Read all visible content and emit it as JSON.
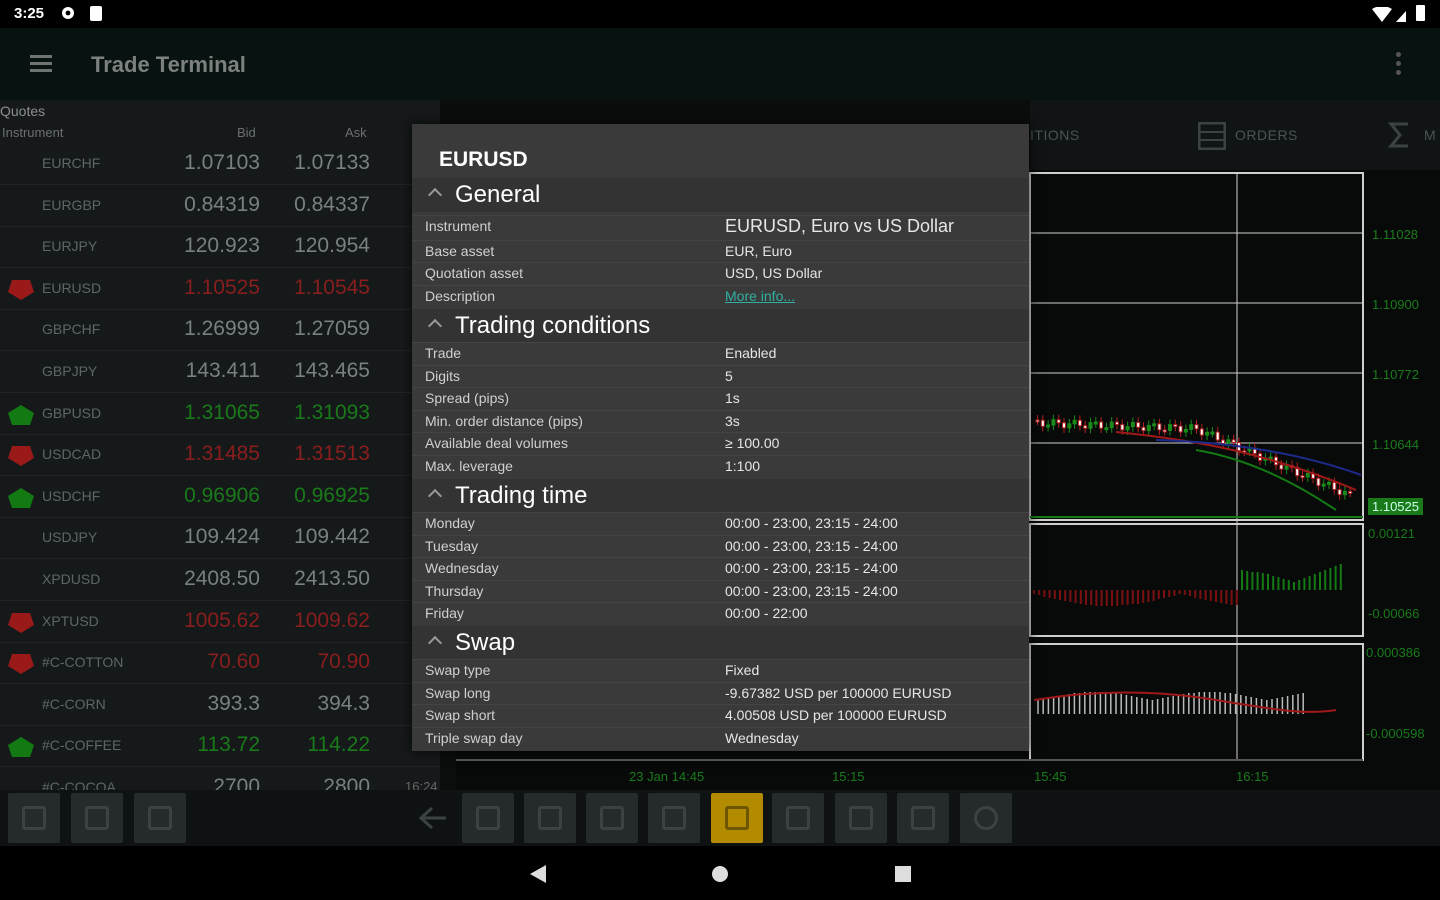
{
  "status_bar": {
    "time": "3:25"
  },
  "app_bar": {
    "title": "Trade Terminal"
  },
  "quotes": {
    "title": "Quotes",
    "headers": {
      "instrument": "Instrument",
      "bid": "Bid",
      "ask": "Ask"
    },
    "rows": [
      {
        "instrument": "EURCHF",
        "bid": "1.07103",
        "ask": "1.07133",
        "dir": "none"
      },
      {
        "instrument": "EURGBP",
        "bid": "0.84319",
        "ask": "0.84337",
        "dir": "none"
      },
      {
        "instrument": "EURJPY",
        "bid": "120.923",
        "ask": "120.954",
        "dir": "none"
      },
      {
        "instrument": "EURUSD",
        "bid": "1.10525",
        "ask": "1.10545",
        "dir": "down"
      },
      {
        "instrument": "GBPCHF",
        "bid": "1.26999",
        "ask": "1.27059",
        "dir": "none"
      },
      {
        "instrument": "GBPJPY",
        "bid": "143.411",
        "ask": "143.465",
        "dir": "none"
      },
      {
        "instrument": "GBPUSD",
        "bid": "1.31065",
        "ask": "1.31093",
        "dir": "up"
      },
      {
        "instrument": "USDCAD",
        "bid": "1.31485",
        "ask": "1.31513",
        "dir": "down"
      },
      {
        "instrument": "USDCHF",
        "bid": "0.96906",
        "ask": "0.96925",
        "dir": "up"
      },
      {
        "instrument": "USDJPY",
        "bid": "109.424",
        "ask": "109.442",
        "dir": "none"
      },
      {
        "instrument": "XPDUSD",
        "bid": "2408.50",
        "ask": "2413.50",
        "dir": "none"
      },
      {
        "instrument": "XPTUSD",
        "bid": "1005.62",
        "ask": "1009.62",
        "dir": "down"
      },
      {
        "instrument": "#C-COTTON",
        "bid": "70.60",
        "ask": "70.90",
        "dir": "down"
      },
      {
        "instrument": "#C-CORN",
        "bid": "393.3",
        "ask": "394.3",
        "dir": "none"
      },
      {
        "instrument": "#C-COFFEE",
        "bid": "113.72",
        "ask": "114.22",
        "dir": "up"
      },
      {
        "instrument": "#C-COCOA",
        "bid": "2700",
        "ask": "2800",
        "dir": "none",
        "extra": "16:24"
      }
    ]
  },
  "right_tabs": {
    "positions": "ITIONS",
    "orders": "ORDERS"
  },
  "chart": {
    "price_labels": [
      "1.11028",
      "1.10900",
      "1.10772",
      "1.10644",
      "1.10525"
    ],
    "osc1_labels": [
      "0.00121",
      "-0.00066"
    ],
    "osc2_labels": [
      "0.000386",
      "-0.000598"
    ],
    "time_labels": [
      "23 Jan 14:45",
      "15:15",
      "15:45",
      "16:15"
    ],
    "colors": {
      "candle_up": "#1a8a1a",
      "candle_down": "#b02020",
      "grid": "#cfcfcf",
      "label": "#1a7a1a"
    }
  },
  "dialog": {
    "title": "EURUSD",
    "sections": {
      "general": {
        "label": "General",
        "rows": [
          {
            "k": "Instrument",
            "v": "EURUSD, Euro vs US Dollar"
          },
          {
            "k": "Base asset",
            "v": "EUR, Euro"
          },
          {
            "k": "Quotation asset",
            "v": "USD, US Dollar"
          },
          {
            "k": "Description",
            "v": "More info..."
          }
        ]
      },
      "trading_conditions": {
        "label": "Trading conditions",
        "rows": [
          {
            "k": "Trade",
            "v": "Enabled"
          },
          {
            "k": "Digits",
            "v": "5"
          },
          {
            "k": "Spread (pips)",
            "v": "1s"
          },
          {
            "k": "Min. order distance (pips)",
            "v": "3s"
          },
          {
            "k": "Available deal volumes",
            "v": "≥ 100.00"
          },
          {
            "k": "Max. leverage",
            "v": "1:100"
          }
        ]
      },
      "trading_time": {
        "label": "Trading time",
        "rows": [
          {
            "k": "Monday",
            "v": "00:00 - 23:00, 23:15 - 24:00"
          },
          {
            "k": "Tuesday",
            "v": "00:00 - 23:00, 23:15 - 24:00"
          },
          {
            "k": "Wednesday",
            "v": "00:00 - 23:00, 23:15 - 24:00"
          },
          {
            "k": "Thursday",
            "v": "00:00 - 23:00, 23:15 - 24:00"
          },
          {
            "k": "Friday",
            "v": "00:00 - 22:00"
          }
        ]
      },
      "swap": {
        "label": "Swap",
        "rows": [
          {
            "k": "Swap type",
            "v": "Fixed"
          },
          {
            "k": "Swap long",
            "v": "-9.67382 USD per 100000 EURUSD"
          },
          {
            "k": "Swap short",
            "v": "4.00508 USD per 100000 EURUSD"
          },
          {
            "k": "Triple swap day",
            "v": "Wednesday"
          }
        ]
      }
    }
  },
  "icons": {
    "toolbar": [
      "plus-icon",
      "pencil-icon",
      "sort-icon",
      "back-arrow-icon",
      "check-icon",
      "settings-chart-icon",
      "function-icon",
      "chart-icon",
      "active-chart-icon",
      "list-icon",
      "ruler-icon",
      "info-square-icon",
      "info-circle-icon"
    ],
    "nav": [
      "back-triangle-icon",
      "home-circle-icon",
      "recents-square-icon"
    ]
  }
}
